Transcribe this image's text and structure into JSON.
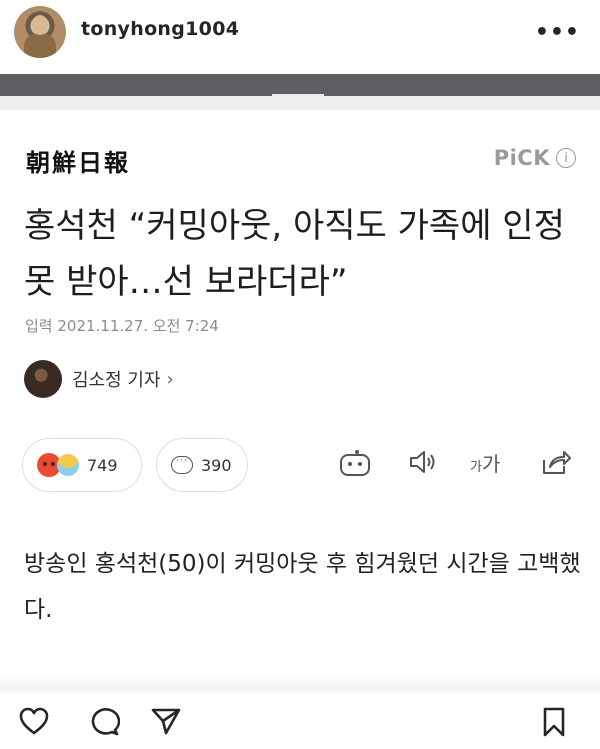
{
  "post": {
    "username": "tonyhong1004",
    "more_label": "•••"
  },
  "article": {
    "masthead": "朝鮮日報",
    "pick_label": "PiCK",
    "info_glyph": "i",
    "headline": "홍석천 “커밍아웃, 아직도 가족에 인정 못 받아…선 보라더라”",
    "date": "입력 2021.11.27. 오전 7:24",
    "reporter": "김소정 기자",
    "reporter_chevron": "›",
    "reactions_count": "749",
    "comments_count": "390",
    "font_size_small": "가",
    "font_size_large": "가",
    "body": "방송인 홍석천(50)이 커밍아웃 후 힘겨웠던 시간을 고백했다."
  },
  "icons": {
    "like": "heart-icon",
    "comment": "comment-icon",
    "share": "send-icon",
    "save": "bookmark-icon"
  }
}
